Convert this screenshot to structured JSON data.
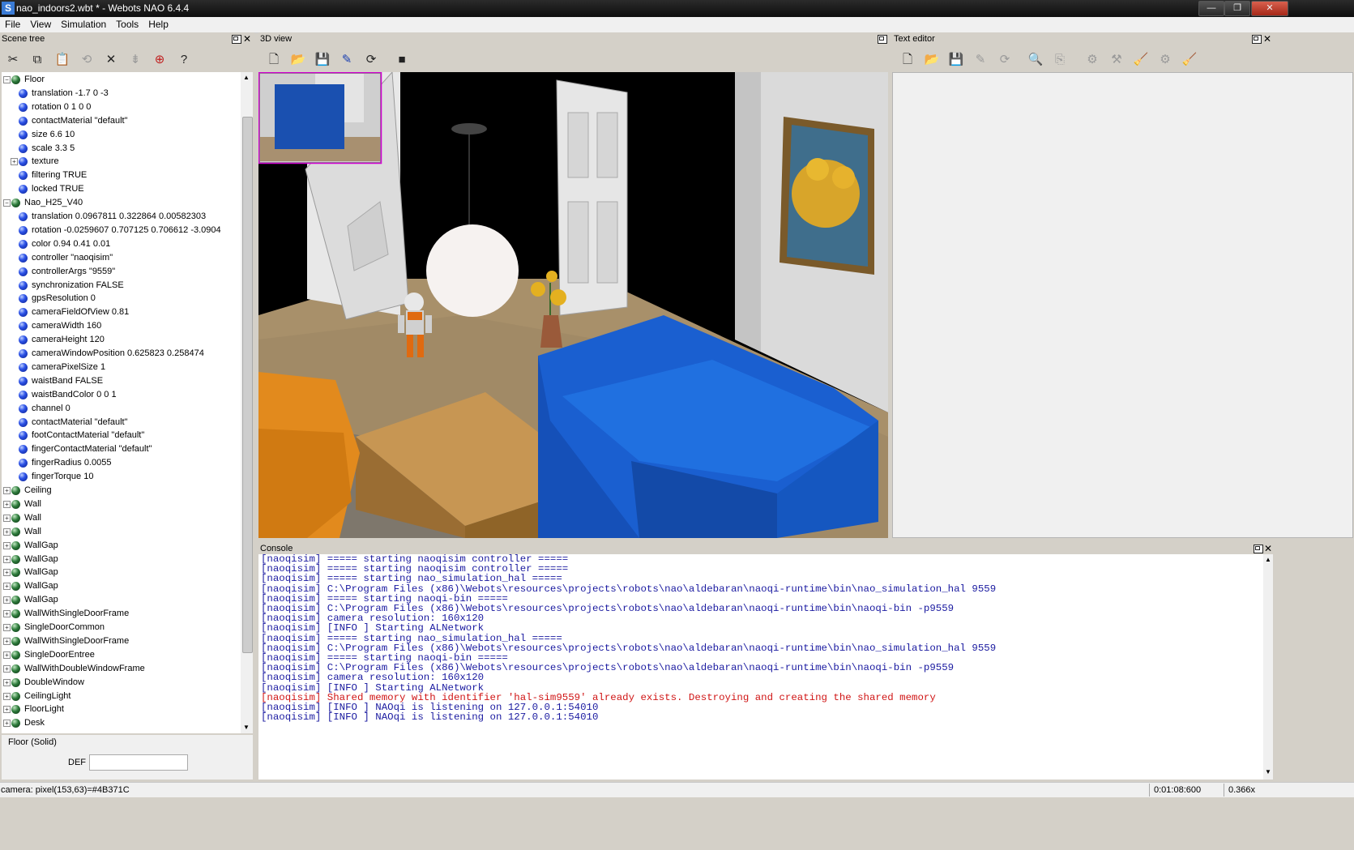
{
  "window": {
    "title": "nao_indoors2.wbt * - Webots NAO 6.4.4",
    "app_icon": "S",
    "minimize": "—",
    "maximize": "❐",
    "close": "✕"
  },
  "menu": [
    "File",
    "View",
    "Simulation",
    "Tools",
    "Help"
  ],
  "panels": {
    "scene_tree": "Scene tree",
    "view3d": "3D view",
    "text_editor": "Text editor",
    "console": "Console"
  },
  "scene_tree": {
    "rows": [
      {
        "indent": 0,
        "kind": "node",
        "expanded": true,
        "label": "Floor"
      },
      {
        "indent": 1,
        "kind": "field",
        "label": "translation -1.7 0 -3"
      },
      {
        "indent": 1,
        "kind": "field",
        "label": "rotation 0 1 0 0"
      },
      {
        "indent": 1,
        "kind": "field",
        "label": "contactMaterial \"default\""
      },
      {
        "indent": 1,
        "kind": "field",
        "label": "size 6.6 10"
      },
      {
        "indent": 1,
        "kind": "field",
        "label": "scale 3.3 5"
      },
      {
        "indent": 1,
        "kind": "field",
        "expandable": true,
        "label": "texture"
      },
      {
        "indent": 1,
        "kind": "field",
        "label": "filtering TRUE"
      },
      {
        "indent": 1,
        "kind": "field",
        "label": "locked TRUE"
      },
      {
        "indent": 0,
        "kind": "node",
        "expanded": true,
        "label": "Nao_H25_V40"
      },
      {
        "indent": 1,
        "kind": "field",
        "label": "translation 0.0967811 0.322864 0.00582303"
      },
      {
        "indent": 1,
        "kind": "field",
        "label": "rotation -0.0259607 0.707125 0.706612 -3.0904"
      },
      {
        "indent": 1,
        "kind": "field",
        "label": "color 0.94 0.41 0.01"
      },
      {
        "indent": 1,
        "kind": "field",
        "label": "controller \"naoqisim\""
      },
      {
        "indent": 1,
        "kind": "field",
        "label": "controllerArgs \"9559\""
      },
      {
        "indent": 1,
        "kind": "field",
        "label": "synchronization FALSE"
      },
      {
        "indent": 1,
        "kind": "field",
        "label": "gpsResolution 0"
      },
      {
        "indent": 1,
        "kind": "field",
        "label": "cameraFieldOfView 0.81"
      },
      {
        "indent": 1,
        "kind": "field",
        "label": "cameraWidth 160"
      },
      {
        "indent": 1,
        "kind": "field",
        "label": "cameraHeight 120"
      },
      {
        "indent": 1,
        "kind": "field",
        "label": "cameraWindowPosition 0.625823 0.258474"
      },
      {
        "indent": 1,
        "kind": "field",
        "label": "cameraPixelSize 1"
      },
      {
        "indent": 1,
        "kind": "field",
        "label": "waistBand FALSE"
      },
      {
        "indent": 1,
        "kind": "field",
        "label": "waistBandColor 0 0 1"
      },
      {
        "indent": 1,
        "kind": "field",
        "label": "channel 0"
      },
      {
        "indent": 1,
        "kind": "field",
        "label": "contactMaterial \"default\""
      },
      {
        "indent": 1,
        "kind": "field",
        "label": "footContactMaterial \"default\""
      },
      {
        "indent": 1,
        "kind": "field",
        "label": "fingerContactMaterial \"default\""
      },
      {
        "indent": 1,
        "kind": "field",
        "label": "fingerRadius 0.0055"
      },
      {
        "indent": 1,
        "kind": "field",
        "label": "fingerTorque 10"
      },
      {
        "indent": 0,
        "kind": "node",
        "expanded": false,
        "label": "Ceiling"
      },
      {
        "indent": 0,
        "kind": "node",
        "expanded": false,
        "label": "Wall"
      },
      {
        "indent": 0,
        "kind": "node",
        "expanded": false,
        "label": "Wall"
      },
      {
        "indent": 0,
        "kind": "node",
        "expanded": false,
        "label": "Wall"
      },
      {
        "indent": 0,
        "kind": "node",
        "expanded": false,
        "label": "WallGap"
      },
      {
        "indent": 0,
        "kind": "node",
        "expanded": false,
        "label": "WallGap"
      },
      {
        "indent": 0,
        "kind": "node",
        "expanded": false,
        "label": "WallGap"
      },
      {
        "indent": 0,
        "kind": "node",
        "expanded": false,
        "label": "WallGap"
      },
      {
        "indent": 0,
        "kind": "node",
        "expanded": false,
        "label": "WallGap"
      },
      {
        "indent": 0,
        "kind": "node",
        "expanded": false,
        "label": "WallWithSingleDoorFrame"
      },
      {
        "indent": 0,
        "kind": "node",
        "expanded": false,
        "label": "SingleDoorCommon"
      },
      {
        "indent": 0,
        "kind": "node",
        "expanded": false,
        "label": "WallWithSingleDoorFrame"
      },
      {
        "indent": 0,
        "kind": "node",
        "expanded": false,
        "label": "SingleDoorEntree"
      },
      {
        "indent": 0,
        "kind": "node",
        "expanded": false,
        "label": "WallWithDoubleWindowFrame"
      },
      {
        "indent": 0,
        "kind": "node",
        "expanded": false,
        "label": "DoubleWindow"
      },
      {
        "indent": 0,
        "kind": "node",
        "expanded": false,
        "label": "CeilingLight"
      },
      {
        "indent": 0,
        "kind": "node",
        "expanded": false,
        "label": "FloorLight"
      },
      {
        "indent": 0,
        "kind": "node",
        "expanded": false,
        "label": "Desk"
      }
    ]
  },
  "node_info": {
    "title": "Floor (Solid)",
    "def_label": "DEF",
    "def_value": ""
  },
  "console_lines": [
    {
      "text": "[naoqisim] ===== starting naoqisim controller =====",
      "error": false
    },
    {
      "text": "[naoqisim] ===== starting naoqisim controller =====",
      "error": false
    },
    {
      "text": "[naoqisim] ===== starting nao_simulation_hal =====",
      "error": false
    },
    {
      "text": "[naoqisim] C:\\Program Files (x86)\\Webots\\resources\\projects\\robots\\nao\\aldebaran\\naoqi-runtime\\bin\\nao_simulation_hal 9559",
      "error": false
    },
    {
      "text": "[naoqisim] ===== starting naoqi-bin =====",
      "error": false
    },
    {
      "text": "[naoqisim] C:\\Program Files (x86)\\Webots\\resources\\projects\\robots\\nao\\aldebaran\\naoqi-runtime\\bin\\naoqi-bin -p9559",
      "error": false
    },
    {
      "text": "[naoqisim] camera resolution: 160x120",
      "error": false
    },
    {
      "text": "[naoqisim] [INFO ] Starting ALNetwork",
      "error": false
    },
    {
      "text": "[naoqisim] ===== starting nao_simulation_hal =====",
      "error": false
    },
    {
      "text": "[naoqisim] C:\\Program Files (x86)\\Webots\\resources\\projects\\robots\\nao\\aldebaran\\naoqi-runtime\\bin\\nao_simulation_hal 9559",
      "error": false
    },
    {
      "text": "[naoqisim] ===== starting naoqi-bin =====",
      "error": false
    },
    {
      "text": "[naoqisim] C:\\Program Files (x86)\\Webots\\resources\\projects\\robots\\nao\\aldebaran\\naoqi-runtime\\bin\\naoqi-bin -p9559",
      "error": false
    },
    {
      "text": "[naoqisim] camera resolution: 160x120",
      "error": false
    },
    {
      "text": "[naoqisim] [INFO ] Starting ALNetwork",
      "error": false
    },
    {
      "text": "[naoqisim] Shared memory with identifier 'hal-sim9559' already exists. Destroying and creating the shared memory",
      "error": true
    },
    {
      "text": "[naoqisim] [INFO ] NAOqi is listening on 127.0.0.1:54010",
      "error": false
    },
    {
      "text": "[naoqisim] [INFO ] NAOqi is listening on 127.0.0.1:54010",
      "error": false
    }
  ],
  "status": {
    "left": "camera: pixel(153,63)=#4B371C",
    "time": "0:01:08:600",
    "speed": "0.366x"
  },
  "icons": {
    "cut": "✂",
    "copy": "⧉",
    "paste": "📋",
    "reset": "⟲",
    "delete": "✕",
    "insert": "⊕",
    "help": "?",
    "new": "🗋",
    "open": "📂",
    "save": "💾",
    "save_as": "✎",
    "revert": "⟳",
    "stop": "■",
    "find": "🔍",
    "replace": "⎘",
    "build": "⚙",
    "clean": "🧹",
    "compile": "⚒"
  },
  "colors": {
    "console_text": "#1a1aa0",
    "console_error": "#d01515",
    "robot_orange": "#e06a10",
    "sofa_blue": "#1a5fd0"
  }
}
